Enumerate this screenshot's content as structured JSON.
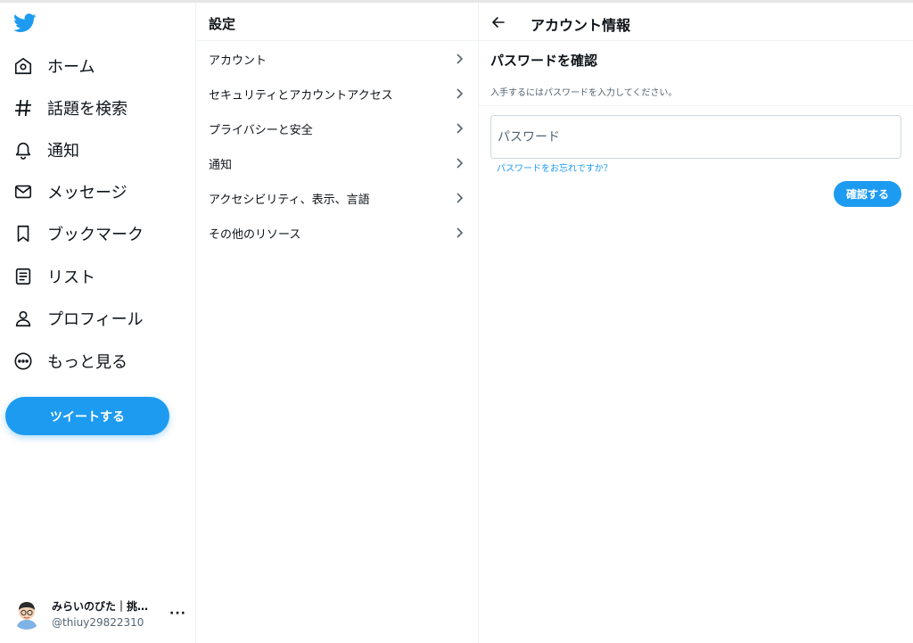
{
  "nav": {
    "items": [
      {
        "label": "ホーム",
        "icon": "home-icon"
      },
      {
        "label": "話題を検索",
        "icon": "hashtag-icon"
      },
      {
        "label": "通知",
        "icon": "bell-icon"
      },
      {
        "label": "メッセージ",
        "icon": "mail-icon"
      },
      {
        "label": "ブックマーク",
        "icon": "bookmark-icon"
      },
      {
        "label": "リスト",
        "icon": "list-icon"
      },
      {
        "label": "プロフィール",
        "icon": "person-icon"
      },
      {
        "label": "もっと見る",
        "icon": "more-circle-icon"
      }
    ],
    "tweet_label": "ツイートする",
    "account": {
      "name": "みらいのびた｜挑…",
      "handle": "@thiuy29822310",
      "more": "···"
    }
  },
  "settings": {
    "title": "設定",
    "items": [
      {
        "label": "アカウント"
      },
      {
        "label": "セキュリティとアカウントアクセス"
      },
      {
        "label": "プライバシーと安全"
      },
      {
        "label": "通知"
      },
      {
        "label": "アクセシビリティ、表示、言語"
      },
      {
        "label": "その他のリソース"
      }
    ]
  },
  "detail": {
    "title": "アカウント情報",
    "heading": "パスワードを確認",
    "description": "入手するにはパスワードを入力してください。",
    "password_placeholder": "パスワード",
    "password_value": "",
    "forgot_label": "パスワードをお忘れですか？",
    "confirm_label": "確認する"
  },
  "colors": {
    "accent": "#1d9bf0",
    "text": "#0f1419",
    "secondary": "#536471",
    "divider": "#eff3f4"
  }
}
